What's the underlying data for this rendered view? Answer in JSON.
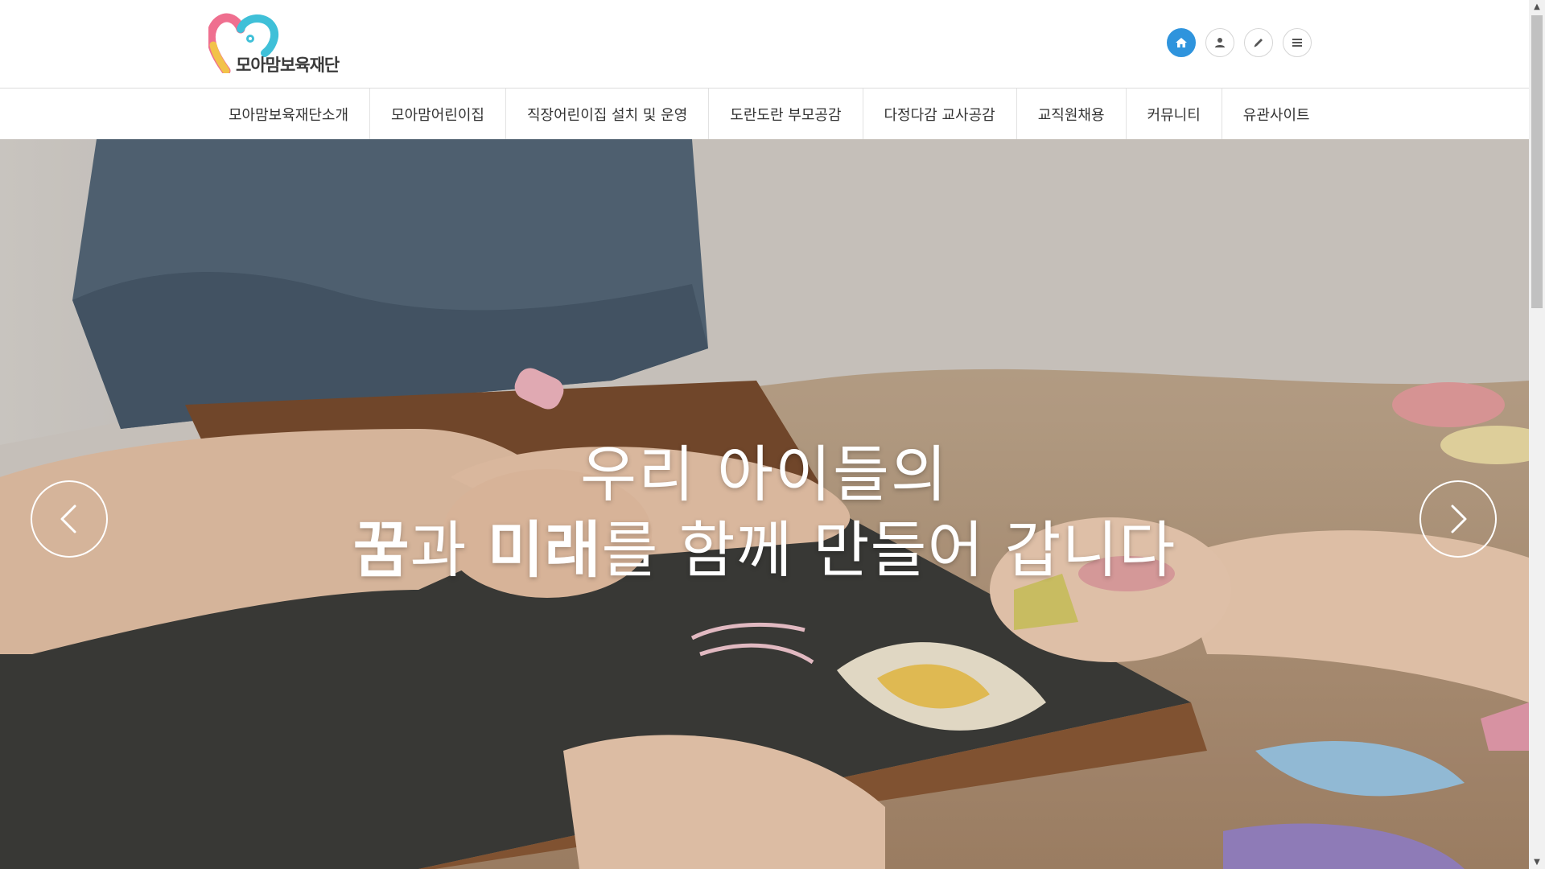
{
  "header": {
    "logo_text": "모아맘보육재단",
    "utility_icons": [
      {
        "name": "home-icon",
        "active": true
      },
      {
        "name": "user-icon",
        "active": false
      },
      {
        "name": "pencil-icon",
        "active": false
      },
      {
        "name": "menu-icon",
        "active": false
      }
    ]
  },
  "nav": {
    "items": [
      {
        "label": "모아맘보육재단소개"
      },
      {
        "label": "모아맘어린이집"
      },
      {
        "label": "직장어린이집 설치 및 운영"
      },
      {
        "label": "도란도란 부모공감"
      },
      {
        "label": "다정다감 교사공감"
      },
      {
        "label": "교직원채용"
      },
      {
        "label": "커뮤니티"
      },
      {
        "label": "유관사이트"
      }
    ]
  },
  "hero": {
    "line1": "우리 아이들의",
    "line2_bold1": "꿈",
    "line2_part2": "과 ",
    "line2_bold2": "미래",
    "line2_part4": "를 함께 만들어 갑니다",
    "prev_icon": "chevron-left-icon",
    "next_icon": "chevron-right-icon"
  },
  "colors": {
    "accent": "#2f94dd",
    "nav_text": "#333333",
    "logo_pink": "#ef6f8f",
    "logo_cyan": "#3fc0d8",
    "logo_yellow": "#f2c24a"
  }
}
